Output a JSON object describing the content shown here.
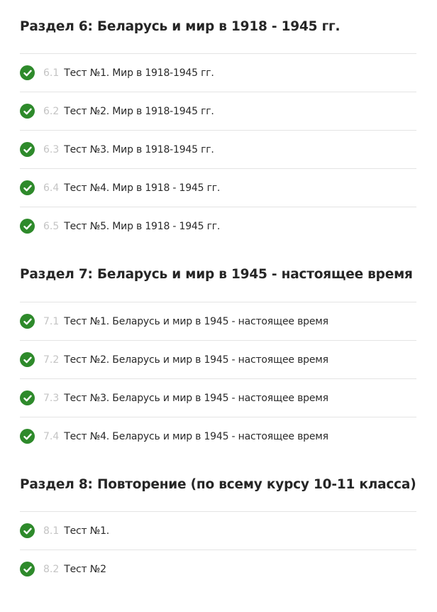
{
  "sections": [
    {
      "title": "Раздел 6: Беларусь и мир в 1918 - 1945 гг.",
      "lessons": [
        {
          "num": "6.1",
          "title": "Тест №1. Мир в 1918-1945 гг."
        },
        {
          "num": "6.2",
          "title": "Тест №2. Мир в 1918-1945 гг."
        },
        {
          "num": "6.3",
          "title": "Тест №3. Мир в 1918-1945 гг."
        },
        {
          "num": "6.4",
          "title": "Тест №4. Мир в 1918 - 1945 гг."
        },
        {
          "num": "6.5",
          "title": "Тест №5. Мир в 1918 - 1945 гг."
        }
      ]
    },
    {
      "title": "Раздел 7: Беларусь и мир в 1945 - настоящее время",
      "lessons": [
        {
          "num": "7.1",
          "title": "Тест №1. Беларусь и мир в 1945 - настоящее время"
        },
        {
          "num": "7.2",
          "title": "Тест №2. Беларусь и мир в 1945 - настоящее время"
        },
        {
          "num": "7.3",
          "title": "Тест №3. Беларусь и мир в 1945 - настоящее время"
        },
        {
          "num": "7.4",
          "title": "Тест №4. Беларусь и мир в 1945 - настоящее время"
        }
      ]
    },
    {
      "title": "Раздел 8: Повторение (по всему курсу 10-11 класса)",
      "lessons": [
        {
          "num": "8.1",
          "title": "Тест №1."
        },
        {
          "num": "8.2",
          "title": "Тест №2"
        }
      ]
    }
  ],
  "icons": {
    "completed": "check-circle-icon"
  },
  "colors": {
    "check_bg": "#2e8a2b",
    "number": "#c4c4c4",
    "divider": "#e4e4e4"
  }
}
